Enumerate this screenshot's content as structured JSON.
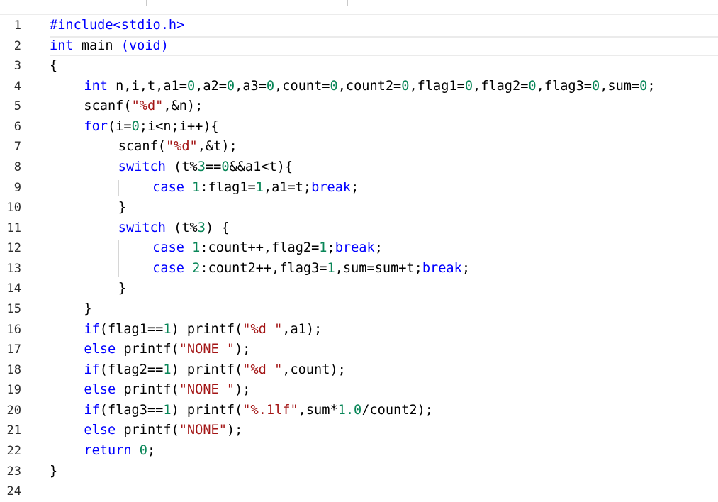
{
  "editor": {
    "line_numbers": [
      "1",
      "2",
      "3",
      "4",
      "5",
      "6",
      "7",
      "8",
      "9",
      "10",
      "11",
      "12",
      "13",
      "14",
      "15",
      "16",
      "17",
      "18",
      "19",
      "20",
      "21",
      "22",
      "23",
      "24"
    ],
    "lines": [
      {
        "indent": 0,
        "tokens": [
          [
            "pp",
            "#include<stdio.h>"
          ]
        ]
      },
      {
        "indent": 0,
        "tokens": [
          [
            "kw",
            "int"
          ],
          [
            "txt",
            " main "
          ],
          [
            "kw",
            "(void)"
          ]
        ]
      },
      {
        "indent": 0,
        "tokens": [
          [
            "txt",
            "{"
          ]
        ]
      },
      {
        "indent": 1,
        "tokens": [
          [
            "kw",
            "int"
          ],
          [
            "txt",
            " n,i,t,a1="
          ],
          [
            "num",
            "0"
          ],
          [
            "txt",
            ",a2="
          ],
          [
            "num",
            "0"
          ],
          [
            "txt",
            ",a3="
          ],
          [
            "num",
            "0"
          ],
          [
            "txt",
            ",count="
          ],
          [
            "num",
            "0"
          ],
          [
            "txt",
            ",count2="
          ],
          [
            "num",
            "0"
          ],
          [
            "txt",
            ",flag1="
          ],
          [
            "num",
            "0"
          ],
          [
            "txt",
            ",flag2="
          ],
          [
            "num",
            "0"
          ],
          [
            "txt",
            ",flag3="
          ],
          [
            "num",
            "0"
          ],
          [
            "txt",
            ",sum="
          ],
          [
            "num",
            "0"
          ],
          [
            "txt",
            ";"
          ]
        ]
      },
      {
        "indent": 1,
        "tokens": [
          [
            "txt",
            "scanf("
          ],
          [
            "str",
            "\"%d\""
          ],
          [
            "txt",
            ",&n);"
          ]
        ]
      },
      {
        "indent": 1,
        "tokens": [
          [
            "kw",
            "for"
          ],
          [
            "txt",
            "(i="
          ],
          [
            "num",
            "0"
          ],
          [
            "txt",
            ";i<n;i++){"
          ]
        ]
      },
      {
        "indent": 2,
        "tokens": [
          [
            "txt",
            "scanf("
          ],
          [
            "str",
            "\"%d\""
          ],
          [
            "txt",
            ",&t);"
          ]
        ]
      },
      {
        "indent": 2,
        "tokens": [
          [
            "kw",
            "switch"
          ],
          [
            "txt",
            " (t%"
          ],
          [
            "num",
            "3"
          ],
          [
            "txt",
            "=="
          ],
          [
            "num",
            "0"
          ],
          [
            "txt",
            "&&a1<t){"
          ]
        ]
      },
      {
        "indent": 3,
        "tokens": [
          [
            "kw",
            "case"
          ],
          [
            "txt",
            " "
          ],
          [
            "num",
            "1"
          ],
          [
            "txt",
            ":flag1="
          ],
          [
            "num",
            "1"
          ],
          [
            "txt",
            ",a1=t;"
          ],
          [
            "kw",
            "break"
          ],
          [
            "txt",
            ";"
          ]
        ]
      },
      {
        "indent": 2,
        "tokens": [
          [
            "txt",
            "}"
          ]
        ]
      },
      {
        "indent": 2,
        "tokens": [
          [
            "kw",
            "switch"
          ],
          [
            "txt",
            " (t%"
          ],
          [
            "num",
            "3"
          ],
          [
            "txt",
            ") {"
          ]
        ]
      },
      {
        "indent": 3,
        "tokens": [
          [
            "kw",
            "case"
          ],
          [
            "txt",
            " "
          ],
          [
            "num",
            "1"
          ],
          [
            "txt",
            ":count++,flag2="
          ],
          [
            "num",
            "1"
          ],
          [
            "txt",
            ";"
          ],
          [
            "kw",
            "break"
          ],
          [
            "txt",
            ";"
          ]
        ]
      },
      {
        "indent": 3,
        "tokens": [
          [
            "kw",
            "case"
          ],
          [
            "txt",
            " "
          ],
          [
            "num",
            "2"
          ],
          [
            "txt",
            ":count2++,flag3="
          ],
          [
            "num",
            "1"
          ],
          [
            "txt",
            ",sum=sum+t;"
          ],
          [
            "kw",
            "break"
          ],
          [
            "txt",
            ";"
          ]
        ]
      },
      {
        "indent": 2,
        "tokens": [
          [
            "txt",
            "}"
          ]
        ]
      },
      {
        "indent": 1,
        "tokens": [
          [
            "txt",
            "}"
          ]
        ]
      },
      {
        "indent": 1,
        "tokens": [
          [
            "kw",
            "if"
          ],
          [
            "txt",
            "(flag1=="
          ],
          [
            "num",
            "1"
          ],
          [
            "txt",
            ") printf("
          ],
          [
            "str",
            "\"%d \""
          ],
          [
            "txt",
            ",a1);"
          ]
        ]
      },
      {
        "indent": 1,
        "tokens": [
          [
            "kw",
            "else"
          ],
          [
            "txt",
            " printf("
          ],
          [
            "str",
            "\"NONE \""
          ],
          [
            "txt",
            ");"
          ]
        ]
      },
      {
        "indent": 1,
        "tokens": [
          [
            "kw",
            "if"
          ],
          [
            "txt",
            "(flag2=="
          ],
          [
            "num",
            "1"
          ],
          [
            "txt",
            ") printf("
          ],
          [
            "str",
            "\"%d \""
          ],
          [
            "txt",
            ",count);"
          ]
        ]
      },
      {
        "indent": 1,
        "tokens": [
          [
            "kw",
            "else"
          ],
          [
            "txt",
            " printf("
          ],
          [
            "str",
            "\"NONE \""
          ],
          [
            "txt",
            ");"
          ]
        ]
      },
      {
        "indent": 1,
        "tokens": [
          [
            "kw",
            "if"
          ],
          [
            "txt",
            "(flag3=="
          ],
          [
            "num",
            "1"
          ],
          [
            "txt",
            ") printf("
          ],
          [
            "str",
            "\"%.1lf\""
          ],
          [
            "txt",
            ",sum*"
          ],
          [
            "num",
            "1.0"
          ],
          [
            "txt",
            "/count2);"
          ]
        ]
      },
      {
        "indent": 1,
        "tokens": [
          [
            "kw",
            "else"
          ],
          [
            "txt",
            " printf("
          ],
          [
            "str",
            "\"NONE\""
          ],
          [
            "txt",
            ");"
          ]
        ]
      },
      {
        "indent": 1,
        "tokens": [
          [
            "kw",
            "return"
          ],
          [
            "txt",
            " "
          ],
          [
            "num",
            "0"
          ],
          [
            "txt",
            ";"
          ]
        ]
      },
      {
        "indent": 0,
        "tokens": [
          [
            "txt",
            "}"
          ]
        ]
      },
      {
        "indent": 0,
        "tokens": []
      }
    ],
    "current_line": 1
  },
  "colors": {
    "keyword": "#0000ff",
    "string": "#a31515",
    "number": "#098658",
    "text": "#000000",
    "line_number": "#2b2b2b"
  }
}
